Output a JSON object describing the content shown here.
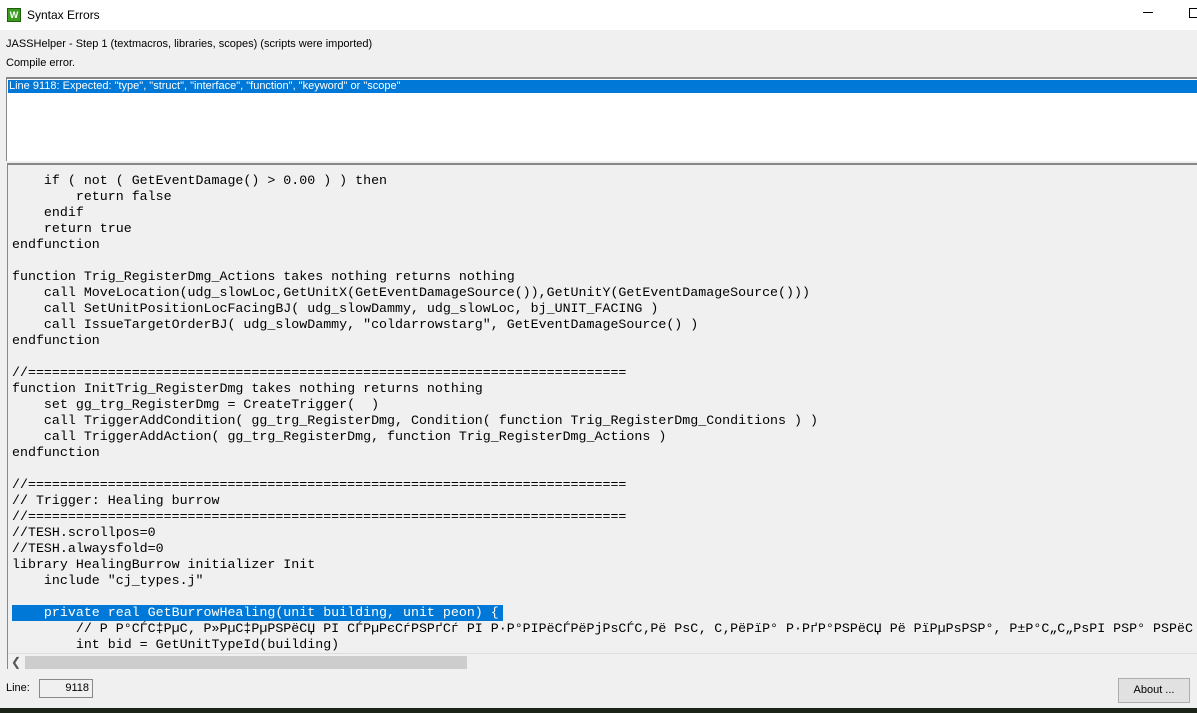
{
  "window": {
    "title": "Syntax Errors",
    "icon": "app-icon"
  },
  "header": {
    "step": "JASSHelper - Step 1 (textmacros, libraries, scopes) (scripts were imported)",
    "status": "Compile error."
  },
  "errors": [
    "Line 9118: Expected: \"type\", \"struct\", \"interface\", \"function\", \"keyword\" or \"scope\""
  ],
  "code": [
    "    if ( not ( GetEventDamage() > 0.00 ) ) then",
    "        return false",
    "    endif",
    "    return true",
    "endfunction",
    "",
    "function Trig_RegisterDmg_Actions takes nothing returns nothing",
    "    call MoveLocation(udg_slowLoc,GetUnitX(GetEventDamageSource()),GetUnitY(GetEventDamageSource()))",
    "    call SetUnitPositionLocFacingBJ( udg_slowDammy, udg_slowLoc, bj_UNIT_FACING )",
    "    call IssueTargetOrderBJ( udg_slowDammy, \"coldarrowstarg\", GetEventDamageSource() )",
    "endfunction",
    "",
    "//===========================================================================",
    "function InitTrig_RegisterDmg takes nothing returns nothing",
    "    set gg_trg_RegisterDmg = CreateTrigger(  )",
    "    call TriggerAddCondition( gg_trg_RegisterDmg, Condition( function Trig_RegisterDmg_Conditions ) )",
    "    call TriggerAddAction( gg_trg_RegisterDmg, function Trig_RegisterDmg_Actions )",
    "endfunction",
    "",
    "//===========================================================================",
    "// Trigger: Healing burrow",
    "//===========================================================================",
    "//TESH.scrollpos=0",
    "//TESH.alwaysfold=0",
    "library HealingBurrow initializer Init",
    "    include \"cj_types.j\"",
    "",
    "    private real GetBurrowHealing(unit building, unit peon) {",
    "        // Р Р°СЃС‡РµС‚ Р»РµС‡РµРЅРёСЏ РІ СЃРµРєСѓРЅРґСѓ РІ Р·Р°РІРёСЃРёРјРѕСЃС‚Рё РѕС‚ С‚РёРїР° Р·РґР°РЅРёСЏ Рё РїРµРѕРЅР°, Р±Р°С„С„РѕРІ РЅР° РЅРёС",
    "        int bid = GetUnitTypeId(building)"
  ],
  "selected_code_line": 27,
  "footer": {
    "line_label": "Line:",
    "line_value": "9118",
    "about_label": "About ..."
  }
}
